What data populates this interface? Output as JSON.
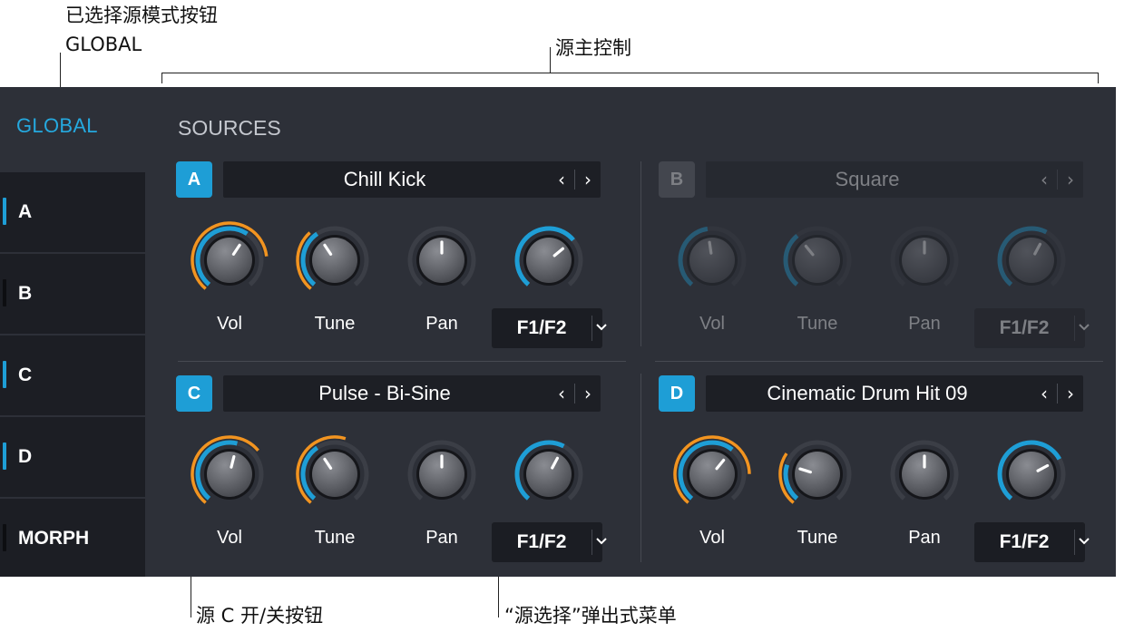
{
  "annotations": {
    "selected_mode_title": "已选择源模式按钮",
    "selected_mode_value": "GLOBAL",
    "master_controls": "源主控制",
    "source_c_toggle": "源 C 开/关按钮",
    "source_popup": "“源选择”弹出式菜单"
  },
  "sidebar": {
    "global_label": "GLOBAL",
    "items": [
      {
        "label": "A",
        "enabled": true
      },
      {
        "label": "B",
        "enabled": false
      },
      {
        "label": "C",
        "enabled": true
      },
      {
        "label": "D",
        "enabled": true
      },
      {
        "label": "MORPH",
        "enabled": false
      }
    ]
  },
  "sources_title": "SOURCES",
  "sources": [
    {
      "id": "A",
      "enabled": true,
      "name": "Chill Kick",
      "vol_label": "Vol",
      "tune_label": "Tune",
      "pan_label": "Pan",
      "filter_label": "F1/F2",
      "vol": 0.62,
      "vol_mod": 0.8,
      "tune": 0.38,
      "tune_mod": 0.35,
      "pan": 0.5,
      "filter": 0.68
    },
    {
      "id": "B",
      "enabled": false,
      "name": "Square",
      "vol_label": "Vol",
      "tune_label": "Tune",
      "pan_label": "Pan",
      "filter_label": "F1/F2",
      "vol": 0.47,
      "vol_mod": 0,
      "tune": 0.36,
      "tune_mod": 0,
      "pan": 0.5,
      "filter": 0.6
    },
    {
      "id": "C",
      "enabled": true,
      "name": "Pulse - Bi-Sine",
      "vol_label": "Vol",
      "tune_label": "Tune",
      "pan_label": "Pan",
      "filter_label": "F1/F2",
      "vol": 0.55,
      "vol_mod": 0.68,
      "tune": 0.38,
      "tune_mod": 0.56,
      "pan": 0.5,
      "filter": 0.6
    },
    {
      "id": "D",
      "enabled": true,
      "name": "Cinematic Drum Hit 09",
      "vol_label": "Vol",
      "tune_label": "Tune",
      "pan_label": "Pan",
      "filter_label": "F1/F2",
      "vol": 0.64,
      "vol_mod": 0.82,
      "tune": 0.24,
      "tune_mod": 0.3,
      "pan": 0.5,
      "filter": 0.72
    }
  ],
  "colors": {
    "accent": "#1e9ed6",
    "mod": "#f29420",
    "track": "#3b3e46",
    "panel": "#2d3038"
  }
}
